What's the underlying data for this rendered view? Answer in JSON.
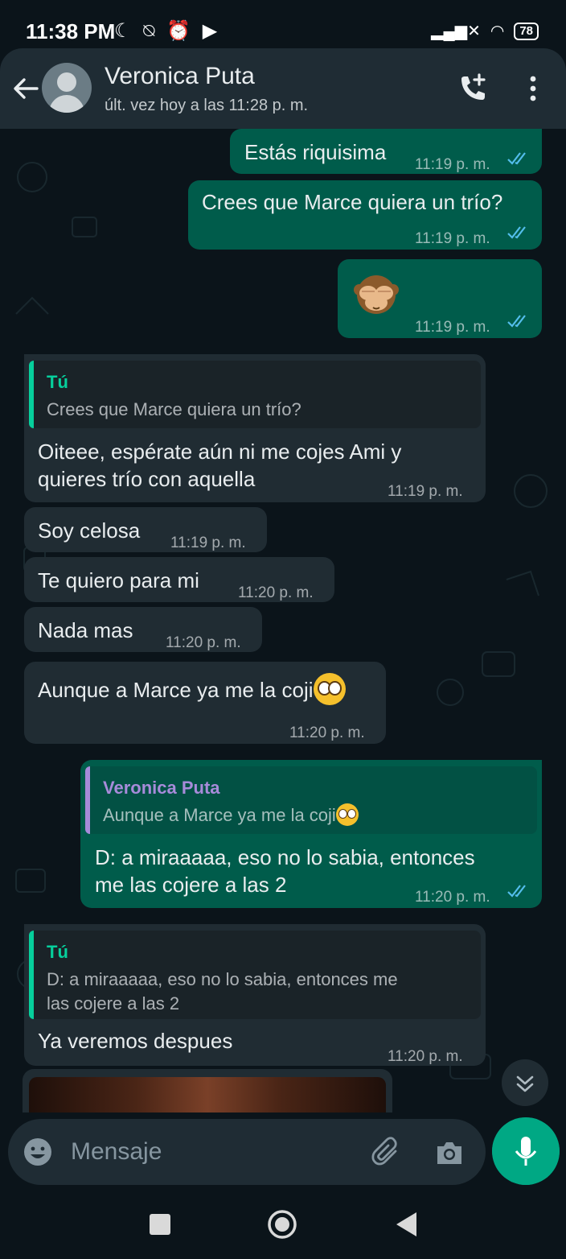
{
  "status_bar": {
    "time": "11:38 PM",
    "icons": "☾ ⍉ ⏰ ▶",
    "signal": "▂▄▆✕",
    "wifi": "◠",
    "battery": "78"
  },
  "header": {
    "contact_name": "Veronica Puta",
    "last_seen": "últ. vez hoy a las 11:28 p. m."
  },
  "messages": [
    {
      "dir": "out",
      "text": "Estás riquisima",
      "time": "11:19 p. m."
    },
    {
      "dir": "out",
      "text": "Crees que Marce quiera un trío?",
      "time": "11:19 p. m."
    },
    {
      "dir": "out",
      "emoji": "see-no-evil-monkey",
      "time": "11:19 p. m."
    },
    {
      "dir": "in",
      "quote_author": "Tú",
      "quote_text": "Crees que Marce quiera un trío?",
      "text_line1": "Oiteee, espérate aún ni me cojes Ami y",
      "text_line2": "quieres trío con aquella",
      "time": "11:19 p. m."
    },
    {
      "dir": "in",
      "text": "Soy celosa",
      "time": "11:19 p. m."
    },
    {
      "dir": "in",
      "text": "Te quiero para mi",
      "time": "11:20 p. m."
    },
    {
      "dir": "in",
      "text": "Nada mas",
      "time": "11:20 p. m."
    },
    {
      "dir": "in",
      "text": "Aunque a Marce ya me la coji",
      "emoji": "flushed-face",
      "time": "11:20 p. m."
    },
    {
      "dir": "out",
      "quote_author": "Veronica Puta",
      "quote_text": "Aunque a Marce ya me la coji",
      "quote_emoji": "flushed-face",
      "text_line1": "D: a miraaaaa, eso no lo sabia, entonces",
      "text_line2": "me las cojere a las 2",
      "time": "11:20 p. m."
    },
    {
      "dir": "in",
      "quote_author": "Tú",
      "quote_text_line1": "D: a miraaaaa, eso no lo sabia, entonces me",
      "quote_text_line2": "las cojere a las 2",
      "text": "Ya veremos despues",
      "time": "11:20 p. m."
    },
    {
      "dir": "in",
      "type": "image"
    }
  ],
  "input": {
    "placeholder": "Mensaje"
  },
  "colors": {
    "outgoing_bubble": "#005c4b",
    "incoming_bubble": "#202c33",
    "read_ticks": "#53bdeb",
    "quote_author_self": "#06cf9c",
    "quote_author_contact": "#a78bda",
    "accent": "#00a884"
  },
  "icons": [
    "back-arrow-icon",
    "avatar-icon",
    "add-call-icon",
    "more-vert-icon",
    "read-ticks-icon",
    "scroll-down-icon",
    "emoji-icon",
    "attach-icon",
    "camera-icon",
    "mic-icon",
    "nav-recents-icon",
    "nav-home-icon",
    "nav-back-icon"
  ]
}
